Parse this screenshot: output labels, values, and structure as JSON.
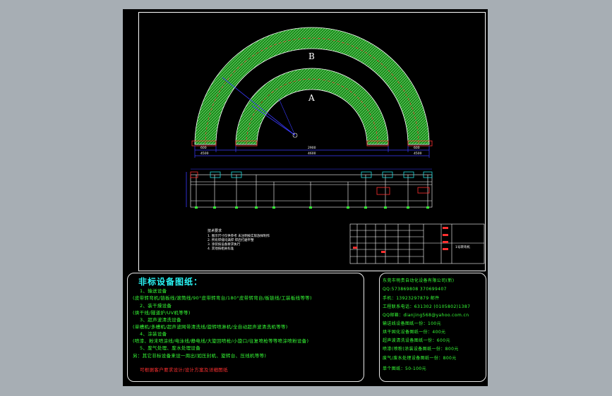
{
  "drawing": {
    "label_outer": "B",
    "label_inner": "A",
    "dim_upper_left": "600",
    "dim_upper_center": "2900",
    "dim_upper_right": "600",
    "dim_lower_left": "4500",
    "dim_lower_center": "4600",
    "dim_lower_right": "4500",
    "tech_title": "技术要求",
    "tech_notes": [
      "1. 图示尺寸仅供参考 未注明按实际放样制作",
      "2. 所有焊缝均满焊 焊后打磨平整",
      "3. 涂装按设备要求执行",
      "4. 其他按相关标准"
    ],
    "title_block_name": "1号转弯机"
  },
  "left_panel": {
    "title": "非标设备图纸：",
    "lines": [
      "1、输送设备",
      "(皮带转弯机/链板线/滚筒线/90°皮带转弯台/180°皮带转弯台/板链线/工装板线等等)",
      "2、装干燥设备",
      "(烘干线/隧道炉/UV机等等)",
      "3、超声波清洗设备",
      "(单槽机/多槽机/超声波网带清洗线/旋转喷淋机/全自动超声波清洗机等等)",
      "4、涂装设备",
      "(喷漆、粉末喷涂线/电泳线/静电线/大旋回喷枪/小旋口/往复喷枪等等喷涂喷粉设备)",
      "5、废气处理、废水处理设备",
      "另：其它非标设备来设一周出(如压封机、旋转台、压线机等等)"
    ],
    "footer": "可根据客户要求设计/设计方案及详细图纸"
  },
  "right_panel": {
    "lines": [
      "东莞市明贵自动化设备有限公司(新)",
      "QQ:573869808   370699407",
      "手机：13923297879   邮件",
      "工程联系电话：631302 (0105802)1387",
      "QQ邮箱：dianjing568@yahoo.com.cn",
      "输送线设备图纸一份：100元",
      "烘干固化设备图纸一份：400元",
      "超声波清洗设备图纸一份：600元",
      "喷漆(喷粉)涂装设备图纸一份：800元",
      "废气/废水处理设备图纸一份：800元",
      "单个图纸：50-100元"
    ]
  },
  "colors": {
    "frame": "#ffffff",
    "belt_fill": "#1f9a1f",
    "panel_text": "#36ff36",
    "panel_title": "#2af5f5",
    "highlight": "#ff3030",
    "dimension": "#3a3aff"
  }
}
